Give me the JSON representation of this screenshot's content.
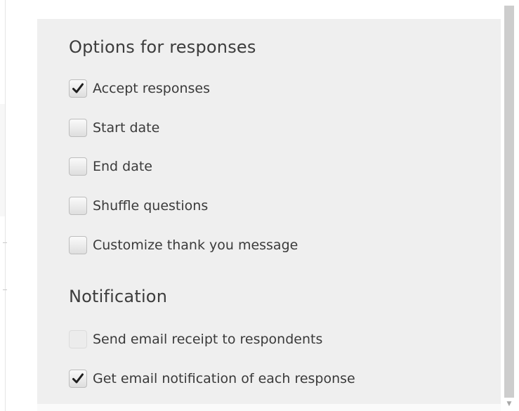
{
  "options_section": {
    "title": "Options for responses",
    "items": [
      {
        "label": "Accept responses",
        "checked": true,
        "disabled": false
      },
      {
        "label": "Start date",
        "checked": false,
        "disabled": false
      },
      {
        "label": "End date",
        "checked": false,
        "disabled": false
      },
      {
        "label": "Shuffle questions",
        "checked": false,
        "disabled": false
      },
      {
        "label": "Customize thank you message",
        "checked": false,
        "disabled": false
      }
    ]
  },
  "notification_section": {
    "title": "Notification",
    "items": [
      {
        "label": "Send email receipt to respondents",
        "checked": false,
        "disabled": true
      },
      {
        "label": "Get email notification of each response",
        "checked": true,
        "disabled": false
      }
    ]
  },
  "icons": {
    "check": "checkmark-icon",
    "scroll_down": "scroll-down-arrow-icon"
  },
  "colors": {
    "panel_background": "#efefef",
    "text": "#3a3a3a",
    "scrollbar_thumb": "#cdcdcd"
  }
}
